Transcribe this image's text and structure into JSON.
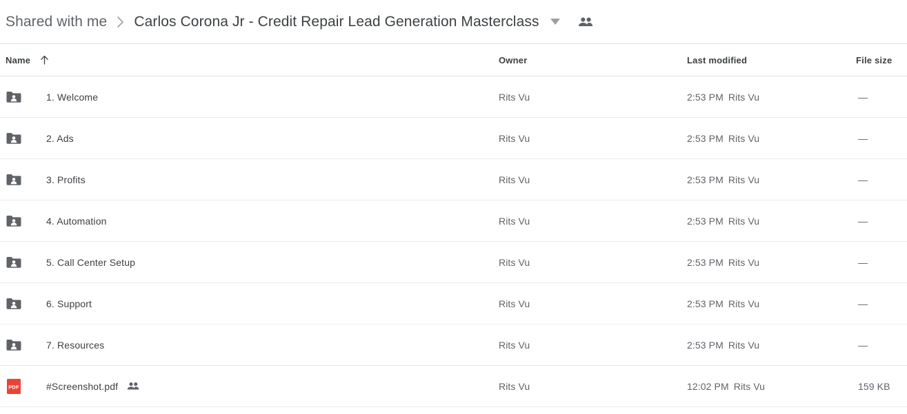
{
  "breadcrumb": {
    "root_label": "Shared with me",
    "separator": "chevron-right-icon",
    "current_label": "Carlos Corona Jr - Credit Repair Lead Generation Masterclass",
    "caret_icon": "chevron-down-icon",
    "people_icon": "people-icon"
  },
  "table": {
    "headers": {
      "name": "Name",
      "owner": "Owner",
      "modified": "Last modified",
      "size": "File size"
    },
    "sort": {
      "column": "Name",
      "direction": "ascending",
      "icon": "arrow-up-icon"
    },
    "rows": [
      {
        "icon": "shared-folder-icon",
        "name": "1. Welcome",
        "shared": false,
        "owner": "Rits Vu",
        "modified_time": "2:53 PM",
        "modified_by": "Rits Vu",
        "size": "—"
      },
      {
        "icon": "shared-folder-icon",
        "name": "2. Ads",
        "shared": false,
        "owner": "Rits Vu",
        "modified_time": "2:53 PM",
        "modified_by": "Rits Vu",
        "size": "—"
      },
      {
        "icon": "shared-folder-icon",
        "name": "3. Profits",
        "shared": false,
        "owner": "Rits Vu",
        "modified_time": "2:53 PM",
        "modified_by": "Rits Vu",
        "size": "—"
      },
      {
        "icon": "shared-folder-icon",
        "name": "4. Automation",
        "shared": false,
        "owner": "Rits Vu",
        "modified_time": "2:53 PM",
        "modified_by": "Rits Vu",
        "size": "—"
      },
      {
        "icon": "shared-folder-icon",
        "name": "5. Call Center Setup",
        "shared": false,
        "owner": "Rits Vu",
        "modified_time": "2:53 PM",
        "modified_by": "Rits Vu",
        "size": "—"
      },
      {
        "icon": "shared-folder-icon",
        "name": "6. Support",
        "shared": false,
        "owner": "Rits Vu",
        "modified_time": "2:53 PM",
        "modified_by": "Rits Vu",
        "size": "—"
      },
      {
        "icon": "shared-folder-icon",
        "name": "7. Resources",
        "shared": false,
        "owner": "Rits Vu",
        "modified_time": "2:53 PM",
        "modified_by": "Rits Vu",
        "size": "—"
      },
      {
        "icon": "pdf-file-icon",
        "name": "#Screenshot.pdf",
        "shared": true,
        "owner": "Rits Vu",
        "modified_time": "12:02 PM",
        "modified_by": "Rits Vu",
        "size": "159 KB"
      }
    ]
  },
  "colors": {
    "folder_icon": "#5f6368",
    "pdf_icon": "#ea4335",
    "text_primary": "#3c4043",
    "text_secondary": "#5f6368",
    "divider": "#e8eaed"
  }
}
